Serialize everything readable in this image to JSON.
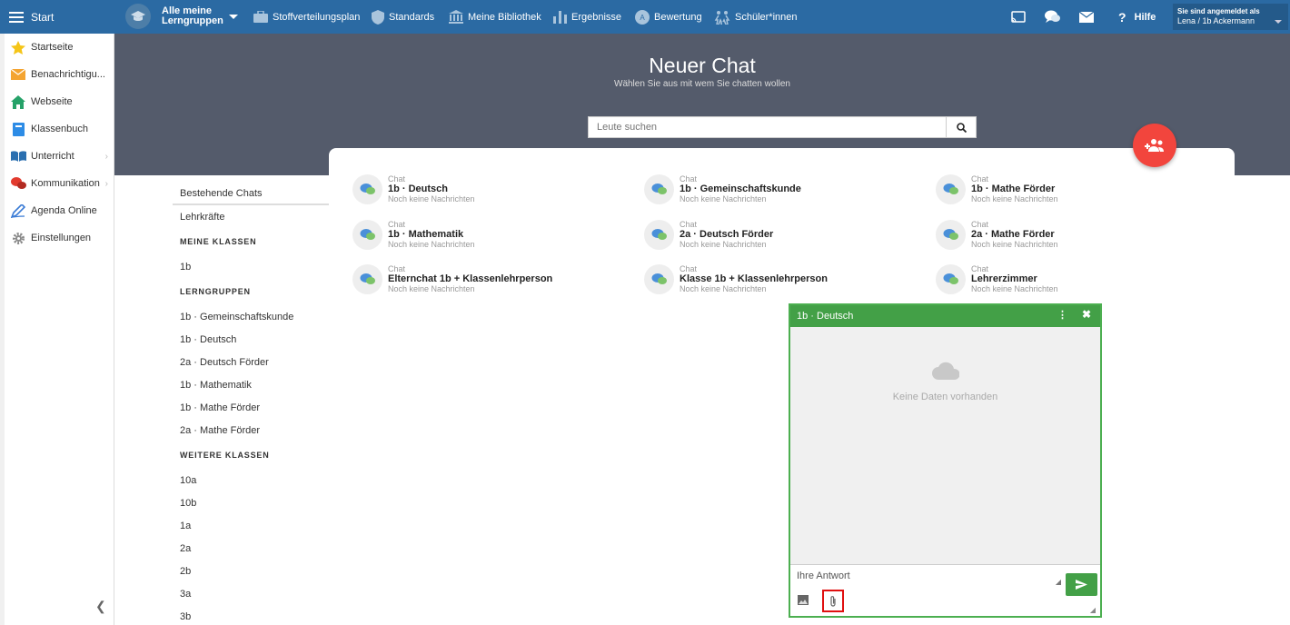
{
  "topbar": {
    "start_label": "Start",
    "learning_groups_label": "Alle meine Lerngruppen",
    "nav": [
      {
        "label": "Stoffverteilungsplan",
        "icon": "briefcase-icon"
      },
      {
        "label": "Standards",
        "icon": "shield-icon"
      },
      {
        "label": "Meine Bibliothek",
        "icon": "library-icon"
      },
      {
        "label": "Ergebnisse",
        "icon": "bar-chart-icon"
      },
      {
        "label": "Bewertung",
        "icon": "grading-icon"
      },
      {
        "label": "Schüler*innen",
        "icon": "students-icon"
      }
    ],
    "help_label": "Hilfe",
    "login_title": "Sie sind angemeldet als",
    "login_user": "Lena / 1b Ackermann"
  },
  "sidebar": {
    "items": [
      {
        "label": "Startseite",
        "icon": "star-icon"
      },
      {
        "label": "Benachrichtigu...",
        "icon": "envelope-icon"
      },
      {
        "label": "Webseite",
        "icon": "home-icon"
      },
      {
        "label": "Klassenbuch",
        "icon": "book-icon"
      },
      {
        "label": "Unterricht",
        "icon": "open-book-icon"
      },
      {
        "label": "Kommunikation",
        "icon": "chat-bubbles-icon"
      },
      {
        "label": "Agenda Online",
        "icon": "pen-icon"
      },
      {
        "label": "Einstellungen",
        "icon": "gear-icon"
      }
    ]
  },
  "hero": {
    "title": "Neuer Chat",
    "subtitle": "Wählen Sie aus mit wem Sie chatten wollen",
    "search_placeholder": "Leute suchen"
  },
  "chat_nav": {
    "existing": "Bestehende Chats",
    "teachers": "Lehrkräfte",
    "my_classes_heading": "MEINE KLASSEN",
    "my_classes": [
      "1b"
    ],
    "groups_heading": "LERNGRUPPEN",
    "groups": [
      "1b · Gemeinschaftskunde",
      "1b · Deutsch",
      "2a · Deutsch Förder",
      "1b · Mathematik",
      "1b · Mathe Förder",
      "2a · Mathe Förder"
    ],
    "more_heading": "WEITERE KLASSEN",
    "more_classes": [
      "10a",
      "10b",
      "1a",
      "2a",
      "2b",
      "3a",
      "3b"
    ]
  },
  "chats": [
    {
      "type": "Chat",
      "name": "1b · Deutsch",
      "status": "Noch keine Nachrichten"
    },
    {
      "type": "Chat",
      "name": "1b · Gemeinschaftskunde",
      "status": "Noch keine Nachrichten"
    },
    {
      "type": "Chat",
      "name": "1b · Mathe Förder",
      "status": "Noch keine Nachrichten"
    },
    {
      "type": "Chat",
      "name": "1b · Mathematik",
      "status": "Noch keine Nachrichten"
    },
    {
      "type": "Chat",
      "name": "2a · Deutsch Förder",
      "status": "Noch keine Nachrichten"
    },
    {
      "type": "Chat",
      "name": "2a · Mathe Förder",
      "status": "Noch keine Nachrichten"
    },
    {
      "type": "Chat",
      "name": "Elternchat 1b + Klassenlehrperson",
      "status": "Noch keine Nachrichten"
    },
    {
      "type": "Chat",
      "name": "Klasse 1b + Klassenlehrperson",
      "status": "Noch keine Nachrichten"
    },
    {
      "type": "Chat",
      "name": "Lehrerzimmer",
      "status": "Noch keine Nachrichten"
    }
  ],
  "chat_window": {
    "title": "1b · Deutsch",
    "empty_text": "Keine Daten vorhanden",
    "reply_placeholder": "Ihre Antwort"
  },
  "colors": {
    "topbar": "#2b6aa3",
    "hero": "#545b6b",
    "accent_green": "#43a047",
    "fab_red": "#f2453d"
  }
}
